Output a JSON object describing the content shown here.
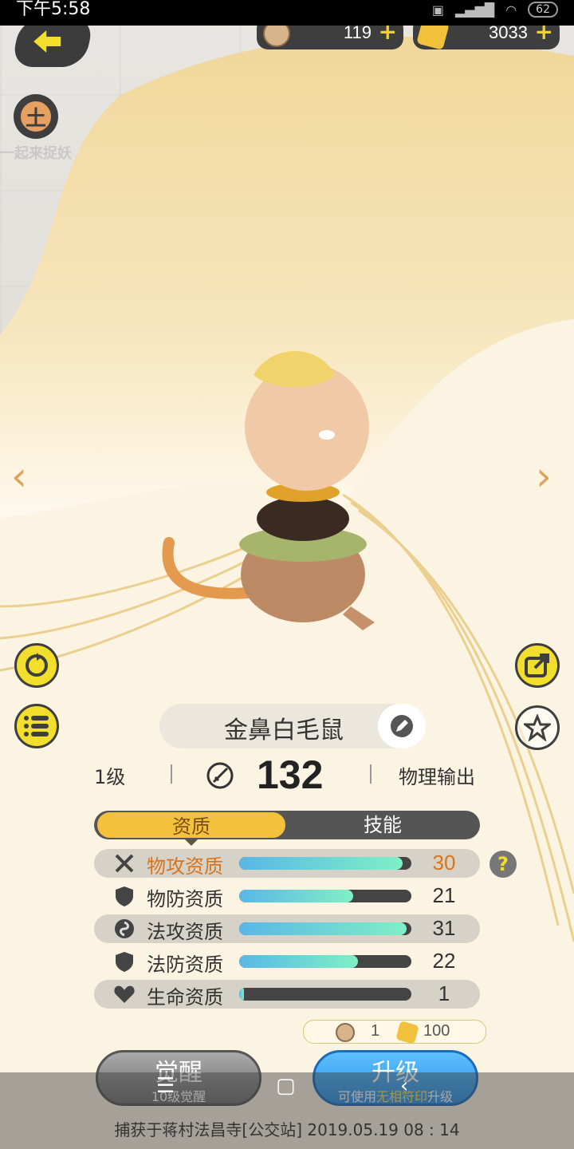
{
  "status_bar": {
    "time": "下午5:58",
    "battery": "62"
  },
  "currencies": [
    {
      "icon": "cat-coin-icon",
      "value": "119"
    },
    {
      "icon": "gold-crystal-icon",
      "value": "3033"
    }
  ],
  "pet": {
    "name": "金鼻白毛鼠",
    "level": "1级",
    "power": "132",
    "role": "物理输出"
  },
  "tabs": [
    {
      "label": "资质",
      "active": true
    },
    {
      "label": "技能",
      "active": false
    }
  ],
  "attributes": [
    {
      "label": "物攻资质",
      "value": "30",
      "fill": 0.95,
      "icon": "crossed-swords-icon",
      "highlight": true
    },
    {
      "label": "物防资质",
      "value": "21",
      "fill": 0.66,
      "icon": "shield-icon",
      "highlight": false
    },
    {
      "label": "法攻资质",
      "value": "31",
      "fill": 0.97,
      "icon": "swirl-icon",
      "highlight": false
    },
    {
      "label": "法防资质",
      "value": "22",
      "fill": 0.69,
      "icon": "shield-icon",
      "highlight": false
    },
    {
      "label": "生命资质",
      "value": "1",
      "fill": 0.03,
      "icon": "heart-icon",
      "highlight": false
    }
  ],
  "help_label": "?",
  "cost": {
    "coin": "1",
    "crystal": "100"
  },
  "buttons": {
    "awaken": {
      "title": "觉醒",
      "sub": "10级觉醒"
    },
    "upgrade": {
      "title": "升级",
      "sub_pre": "可使用",
      "sub_em": "无相符印",
      "sub_post": "升级"
    }
  },
  "capture_info": "捕获于蒋村法昌寺[公交站]  2019.05.19   08 : 14",
  "watermark_text": "一起来捉妖",
  "colors": {
    "accent": "#f4c13c",
    "highlight": "#d9731b",
    "button_blue": "#2a8fe4"
  }
}
